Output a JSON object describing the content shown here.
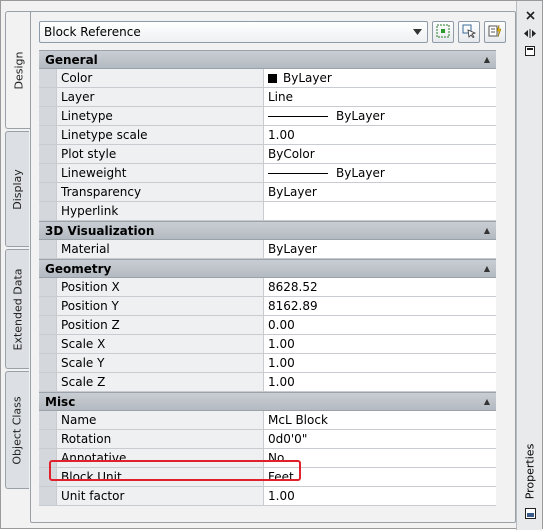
{
  "selector": {
    "value": "Block Reference"
  },
  "tabs": [
    {
      "label": "Design",
      "active": true
    },
    {
      "label": "Display",
      "active": false
    },
    {
      "label": "Extended Data",
      "active": false
    },
    {
      "label": "Object Class",
      "active": false
    }
  ],
  "sections": {
    "general": {
      "title": "General",
      "rows": [
        {
          "label": "Color",
          "value": "ByLayer"
        },
        {
          "label": "Layer",
          "value": "Line"
        },
        {
          "label": "Linetype",
          "value": "ByLayer"
        },
        {
          "label": "Linetype scale",
          "value": "1.00"
        },
        {
          "label": "Plot style",
          "value": "ByColor"
        },
        {
          "label": "Lineweight",
          "value": "ByLayer"
        },
        {
          "label": "Transparency",
          "value": "ByLayer"
        },
        {
          "label": "Hyperlink",
          "value": ""
        }
      ]
    },
    "viz3d": {
      "title": "3D Visualization",
      "rows": [
        {
          "label": "Material",
          "value": "ByLayer"
        }
      ]
    },
    "geometry": {
      "title": "Geometry",
      "rows": [
        {
          "label": "Position X",
          "value": "8628.52"
        },
        {
          "label": "Position Y",
          "value": "8162.89"
        },
        {
          "label": "Position Z",
          "value": "0.00"
        },
        {
          "label": "Scale X",
          "value": "1.00"
        },
        {
          "label": "Scale Y",
          "value": "1.00"
        },
        {
          "label": "Scale Z",
          "value": "1.00"
        }
      ]
    },
    "misc": {
      "title": "Misc",
      "rows": [
        {
          "label": "Name",
          "value": "McL Block"
        },
        {
          "label": "Rotation",
          "value": "0d0'0\""
        },
        {
          "label": "Annotative",
          "value": "No"
        },
        {
          "label": "Block Unit",
          "value": "Feet"
        },
        {
          "label": "Unit factor",
          "value": "1.00"
        }
      ]
    }
  },
  "palette": {
    "title": "Properties"
  },
  "colors": {
    "highlight": "#e0202a",
    "header": "#b4bac1"
  },
  "icons": [
    "add-to-selection-icon",
    "select-objects-icon",
    "quick-select-icon",
    "close-icon",
    "auto-hide-icon",
    "palette-menu-icon"
  ]
}
